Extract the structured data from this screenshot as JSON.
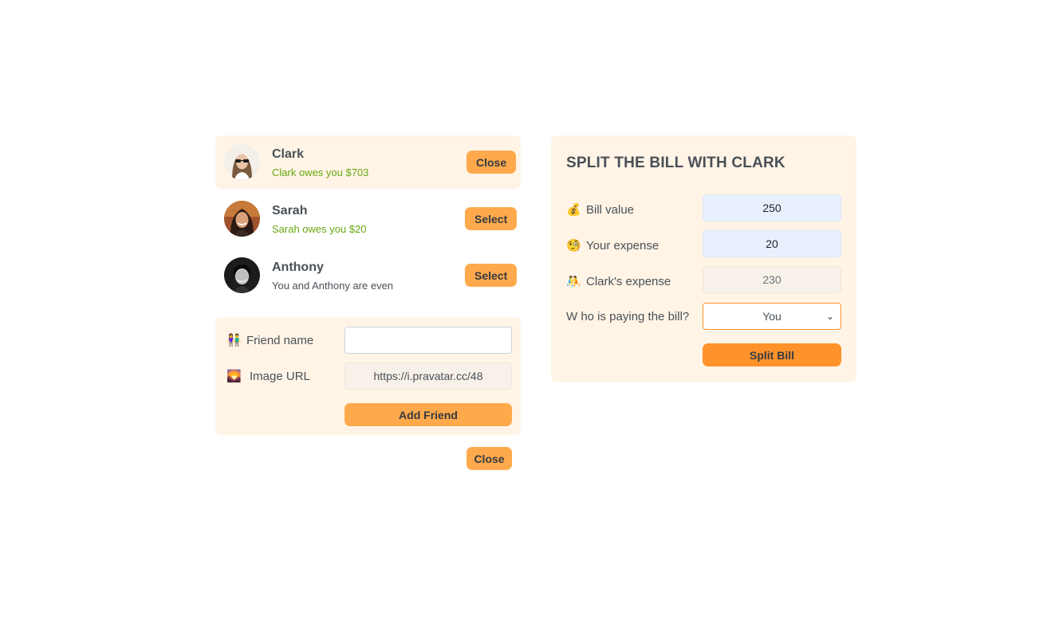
{
  "friends": [
    {
      "name": "Clark",
      "status": "Clark owes you $703",
      "status_type": "positive",
      "button": "Close",
      "selected": true
    },
    {
      "name": "Sarah",
      "status": "Sarah owes you $20",
      "status_type": "positive",
      "button": "Select",
      "selected": false
    },
    {
      "name": "Anthony",
      "status": "You and Anthony are even",
      "status_type": "even",
      "button": "Select",
      "selected": false
    }
  ],
  "add_friend": {
    "name_icon": "👫",
    "name_label": "Friend name",
    "name_value": "",
    "image_icon": "🌄",
    "image_label": "Image URL",
    "image_value": "https://i.pravatar.cc/48",
    "submit_label": "Add Friend"
  },
  "close_form_label": "Close",
  "split": {
    "title": "SPLIT THE BILL WITH CLARK",
    "bill_icon": "💰",
    "bill_label": "Bill value",
    "bill_value": "250",
    "your_icon": "🧐",
    "your_label": "Your expense",
    "your_value": "20",
    "friend_icon": "🤼",
    "friend_label": "Clark's expense",
    "friend_value": "230",
    "payer_label": "W ho is paying the bill?",
    "payer_value": "You",
    "submit_label": "Split Bill"
  },
  "colors": {
    "accent": "#ffa94d",
    "accent_dark": "#ff922b",
    "panel_bg": "#fff4e6",
    "positive": "#66a80f"
  }
}
